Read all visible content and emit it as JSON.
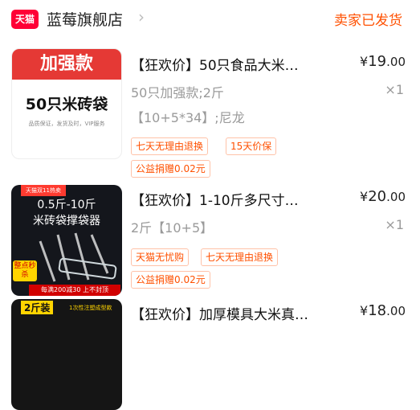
{
  "store": {
    "logo_text": "天猫",
    "name": "蓝莓旗舰店",
    "chevron": "›",
    "status": "卖家已发货"
  },
  "items": [
    {
      "thumb": {
        "banner": "加强款",
        "big_text": "50只米砖袋",
        "small_text": "品质保证，发货及时，VIP服务"
      },
      "title": "【狂欢价】50只食品大米…",
      "price": {
        "currency": "¥",
        "int": "19",
        "dec": ".00"
      },
      "quantity": "×1",
      "spec_line1": "50只加强款;2斤",
      "spec_line2": "【10+5*34】;尼龙",
      "tags": [
        "七天无理由退换",
        "15天价保"
      ],
      "extra_tag": "公益捐赠0.02元"
    },
    {
      "thumb": {
        "badge": "天猫双11热卖",
        "line1": "0.5斤-10斤",
        "line2": "米砖袋撑袋器",
        "promo_a": "整点秒杀",
        "promo_b": "每满200减30 上不封顶"
      },
      "title": "【狂欢价】1-10斤多尺寸…",
      "price": {
        "currency": "¥",
        "int": "20",
        "dec": ".00"
      },
      "quantity": "×1",
      "spec_line1": "2斤【10+5】",
      "tags": [
        "天猫无忧购",
        "七天无理由退换"
      ],
      "extra_tag": "公益捐赠0.02元"
    },
    {
      "thumb": {
        "yellow": "2斤装",
        "small": "1次性注塑成型款"
      },
      "title": "【狂欢价】加厚模具大米真…",
      "price": {
        "currency": "¥",
        "int": "18",
        "dec": ".00"
      }
    }
  ],
  "colors": {
    "accent": "#ff5000",
    "tmall_red": "#ff0036"
  },
  "icons": {
    "chevron": "chevron-right-icon"
  }
}
